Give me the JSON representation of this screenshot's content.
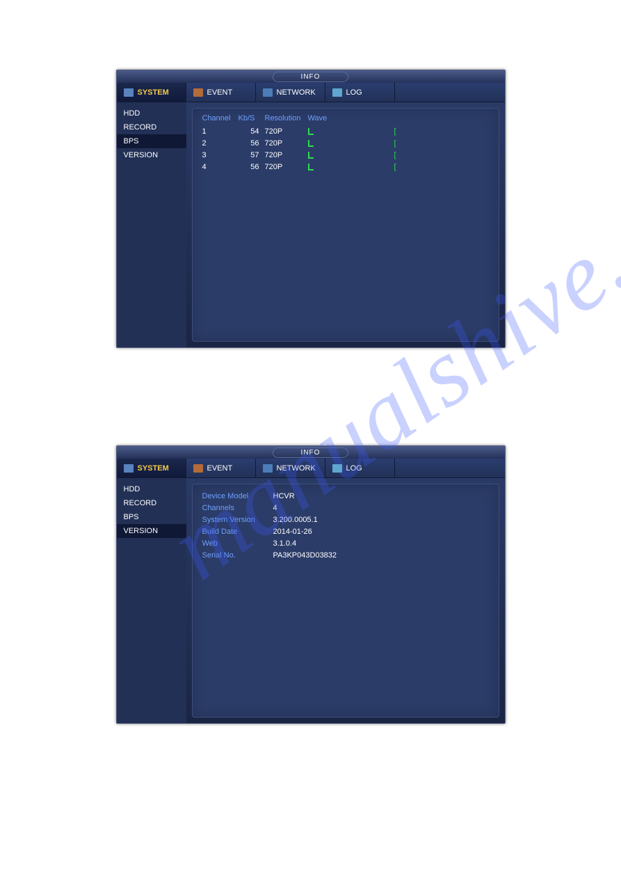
{
  "watermark": "manualshive.com",
  "titlebar": "INFO",
  "tabs": {
    "system": "SYSTEM",
    "event": "EVENT",
    "network": "NETWORK",
    "log": "LOG"
  },
  "sidebar": {
    "hdd": "HDD",
    "record": "RECORD",
    "bps": "BPS",
    "version": "VERSION"
  },
  "bps": {
    "headers": {
      "channel": "Channel",
      "kbs": "Kb/S",
      "resolution": "Resolution",
      "wave": "Wave"
    },
    "rows": [
      {
        "channel": "1",
        "kbs": "54",
        "resolution": "720P"
      },
      {
        "channel": "2",
        "kbs": "56",
        "resolution": "720P"
      },
      {
        "channel": "3",
        "kbs": "57",
        "resolution": "720P"
      },
      {
        "channel": "4",
        "kbs": "56",
        "resolution": "720P"
      }
    ]
  },
  "version": {
    "rows": [
      {
        "k": "Device Model",
        "v": "HCVR"
      },
      {
        "k": "Channels",
        "v": "4"
      },
      {
        "k": "System Version",
        "v": "3.200.0005.1"
      },
      {
        "k": "Build Date",
        "v": "2014-01-26"
      },
      {
        "k": "Web",
        "v": "3.1.0.4"
      },
      {
        "k": "Serial No.",
        "v": "PA3KP043D03832"
      }
    ]
  }
}
